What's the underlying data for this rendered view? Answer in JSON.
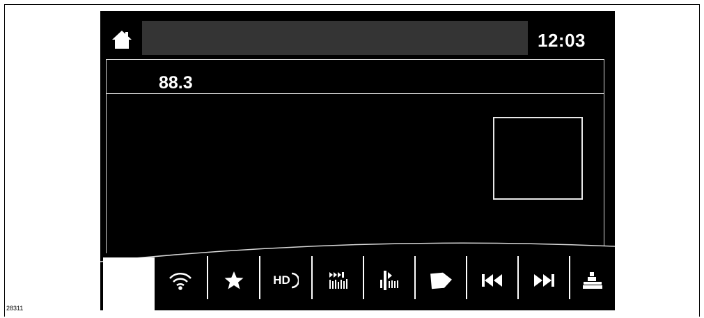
{
  "figure_id": "28311",
  "status_bar": {
    "clock": "12:03",
    "title": ""
  },
  "station": {
    "frequency": "88.3"
  },
  "toolbar": {
    "buttons": [
      {
        "name": "wifi-icon",
        "label": ""
      },
      {
        "name": "star-icon",
        "label": ""
      },
      {
        "name": "hd-icon",
        "label": "HD"
      },
      {
        "name": "scan-icon",
        "label": ""
      },
      {
        "name": "seek-icon",
        "label": ""
      },
      {
        "name": "tag-icon",
        "label": ""
      },
      {
        "name": "previous-icon",
        "label": ""
      },
      {
        "name": "next-icon",
        "label": ""
      },
      {
        "name": "presets-icon",
        "label": ""
      }
    ]
  },
  "colors": {
    "screen_bg": "#000000",
    "title_bar": "#343434",
    "foreground": "#ffffff"
  }
}
